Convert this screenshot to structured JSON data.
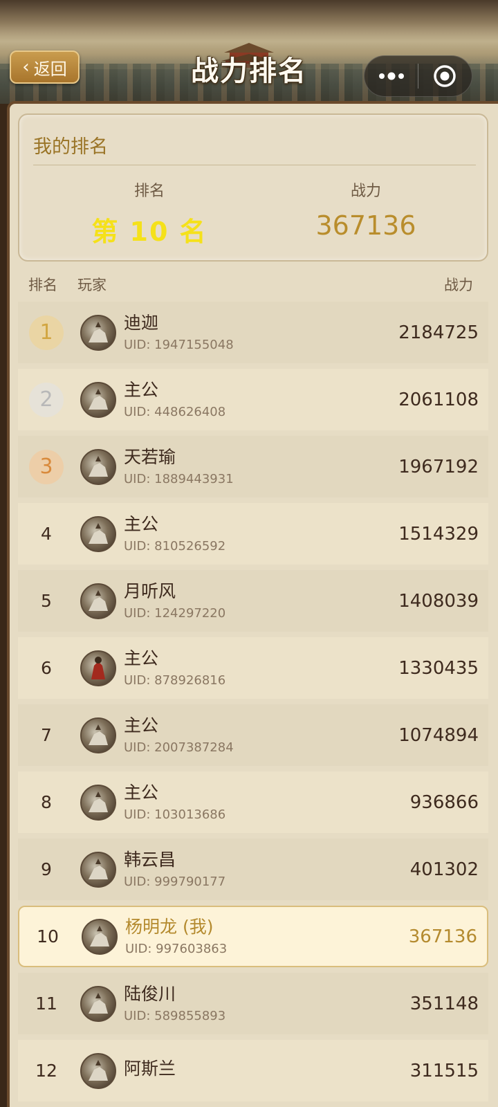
{
  "header": {
    "back_label": "返回",
    "title": "战力排名"
  },
  "my_rank": {
    "title": "我的排名",
    "rank_label": "排名",
    "rank_value": "第 10 名",
    "power_label": "战力",
    "power_value": "367136"
  },
  "columns": {
    "rank": "排名",
    "player": "玩家",
    "power": "战力"
  },
  "rows": [
    {
      "rank": "1",
      "name": "迪迦",
      "uid": "UID: 1947155048",
      "power": "2184725"
    },
    {
      "rank": "2",
      "name": "主公",
      "uid": "UID: 448626408",
      "power": "2061108"
    },
    {
      "rank": "3",
      "name": "天若瑜",
      "uid": "UID: 1889443931",
      "power": "1967192"
    },
    {
      "rank": "4",
      "name": "主公",
      "uid": "UID: 810526592",
      "power": "1514329"
    },
    {
      "rank": "5",
      "name": "月听风",
      "uid": "UID: 124297220",
      "power": "1408039"
    },
    {
      "rank": "6",
      "name": "主公",
      "uid": "UID: 878926816",
      "power": "1330435"
    },
    {
      "rank": "7",
      "name": "主公",
      "uid": "UID: 2007387284",
      "power": "1074894"
    },
    {
      "rank": "8",
      "name": "主公",
      "uid": "UID: 103013686",
      "power": "936866"
    },
    {
      "rank": "9",
      "name": "韩云昌",
      "uid": "UID: 999790177",
      "power": "401302"
    },
    {
      "rank": "10",
      "name": "杨明龙 (我)",
      "uid": "UID: 997603863",
      "power": "367136"
    },
    {
      "rank": "11",
      "name": "陆俊川",
      "uid": "UID: 589855893",
      "power": "351148"
    },
    {
      "rank": "12",
      "name": "阿斯兰",
      "uid": "",
      "power": "311515"
    }
  ],
  "colors": {
    "gold_medal": "#d2a642",
    "silver_medal": "#b8b8b8",
    "bronze_medal": "#d98a3c",
    "rank_highlight": "#f5e11a",
    "accent": "#b48a2e"
  },
  "icons": {
    "back": "chevron-left-icon",
    "more": "more-dots-icon",
    "close": "target-close-icon"
  }
}
